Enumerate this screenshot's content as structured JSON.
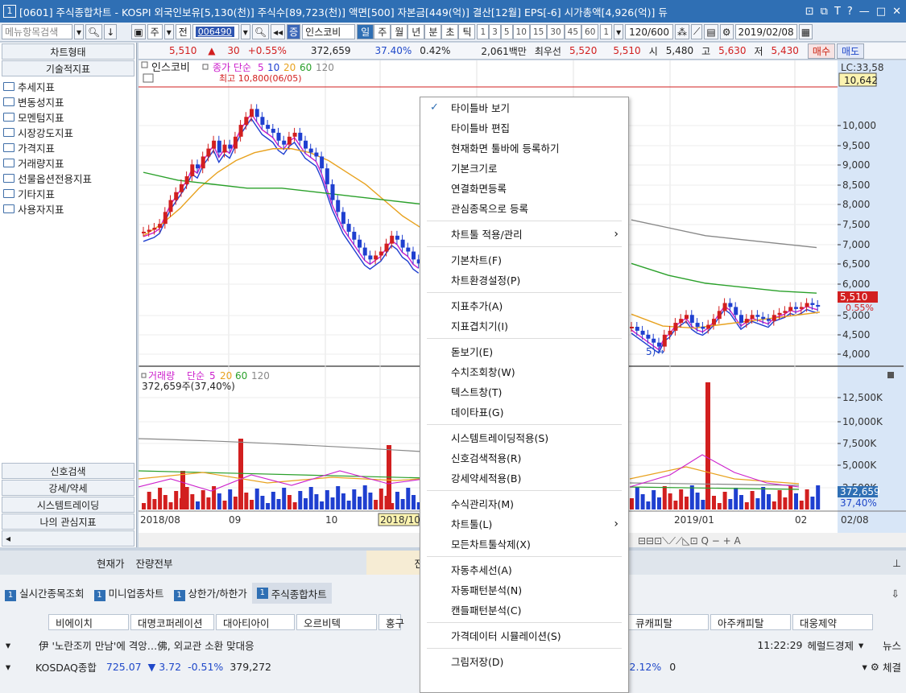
{
  "window": {
    "num": "1",
    "title": "[0601] 주식종합차트 - KOSPI 외국인보유[5,130(천)] 주식수[89,723(천)] 액면[500] 자본금[449(억)] 결산[12월] EPS[-6] 시가총액[4,926(억)] 듀"
  },
  "toolbar": {
    "menu_search": "메뉴항목검색",
    "ju": "주",
    "jeon": "전",
    "code": "006490",
    "name": "인스코비",
    "periods": [
      "일",
      "주",
      "월",
      "년",
      "분",
      "초",
      "틱"
    ],
    "active_period": "일",
    "intervals": [
      "1",
      "3",
      "5",
      "10",
      "15",
      "30",
      "45",
      "60"
    ],
    "count": "1",
    "range": "120",
    "range_total": "/600",
    "date": "2019/02/08"
  },
  "quote": {
    "price": "5,510",
    "arrow": "▲",
    "change": "30",
    "pct": "+0.55%",
    "volume": "372,659",
    "vol_ratio": "37.40%",
    "turnover": "0.42%",
    "amount": "2,061백만",
    "best_label": "최우선",
    "ask": "5,520",
    "bid": "5,510",
    "open_label": "시",
    "open": "5,480",
    "high_label": "고",
    "high": "5,630",
    "low_label": "저",
    "low": "5,430",
    "buy": "매수",
    "sell": "매도"
  },
  "left": {
    "chart_type": "차트형태",
    "tech": "기술적지표",
    "items": [
      "추세지표",
      "변동성지표",
      "모멘텀지표",
      "시장강도지표",
      "가격지표",
      "거래량지표",
      "선물옵션전용지표",
      "기타지표",
      "사용자지표"
    ],
    "bottom": [
      "신호검색",
      "강세/약세",
      "시스템트레이딩",
      "나의 관심지표"
    ]
  },
  "chart": {
    "legend_name": "인스코비",
    "legend_series": "종가 단순",
    "ma": [
      "5",
      "10",
      "20",
      "60",
      "120"
    ],
    "ma_colors": [
      "#cc1fcc",
      "#1f3fd0",
      "#e8a21f",
      "#2aa02a",
      "#888888"
    ],
    "high_note": "최고 10,800(06/05)",
    "lc": "LC:33,58",
    "last_box": "10,642",
    "price_ticks": [
      "10,000",
      "9,500",
      "9,000",
      "8,500",
      "8,000",
      "7,500",
      "7,000",
      "6,500",
      "6,000",
      "5,510",
      "0.55%",
      "5,000",
      "4,500",
      "4,000"
    ],
    "low_note": "5)",
    "vol_legend": "거래량",
    "vol_series": "단순",
    "vol_ma": [
      "5",
      "20",
      "60",
      "120"
    ],
    "vol_text": "372,659주(37,40%)",
    "vol_ticks": [
      "12,500K",
      "10,000K",
      "7,500K",
      "5,000K",
      "2,500K"
    ],
    "vol_last": "372,659",
    "vol_last_pct": "37,40%",
    "x_labels": [
      "2018/08",
      "09",
      "10",
      "2018/10",
      "2019/01",
      "02",
      "02/08"
    ]
  },
  "bottom": {
    "r1": [
      "현재가",
      "잔량전부",
      "잔"
    ],
    "tabs": [
      "실시간종목조회",
      "미니업종차트",
      "상한가/하한가",
      "주식종합차트"
    ],
    "stocks": [
      "비에이치",
      "대명코퍼레이션",
      "대아티아이",
      "오르비텍",
      "홍구",
      "큐캐피탈",
      "아주캐피탈",
      "대웅제약"
    ],
    "news": "伊 '노란조끼 만남'에 격앙…佛, 외교관 소환 맞대응",
    "news_time": "11:22:29",
    "news_src": "헤럴드경제",
    "news_label": "뉴스",
    "idx_name": "KOSDAQ종합",
    "idx_val": "725.07",
    "idx_arrow": "▼",
    "idx_chg": "3.72",
    "idx_pct": "-0.51%",
    "idx_vol": "379,272",
    "idx2": "-2.12%",
    "idx2b": "0",
    "settle": "체결"
  },
  "menu": [
    {
      "label": "타이틀바 보기",
      "chk": true
    },
    {
      "label": "타이틀바 편집"
    },
    {
      "label": "현재화면 툴바에 등록하기"
    },
    {
      "label": "기본크기로"
    },
    {
      "label": "연결화면등록"
    },
    {
      "label": "관심종목으로 등록"
    },
    {
      "sep": true
    },
    {
      "label": "차트툴 적용/관리",
      "sub": true
    },
    {
      "sep": true
    },
    {
      "label": "기본차트(F)"
    },
    {
      "label": "차트환경설정(P)"
    },
    {
      "sep": true
    },
    {
      "label": "지표추가(A)"
    },
    {
      "label": "지표겹치기(I)"
    },
    {
      "sep": true
    },
    {
      "label": "돋보기(E)"
    },
    {
      "label": "수치조회창(W)"
    },
    {
      "label": "텍스트창(T)"
    },
    {
      "label": "데이타표(G)"
    },
    {
      "sep": true
    },
    {
      "label": "시스템트레이딩적용(S)"
    },
    {
      "label": "신호검색적용(R)"
    },
    {
      "label": "강세약세적용(B)"
    },
    {
      "sep": true
    },
    {
      "label": "수식관리자(M)"
    },
    {
      "label": "차트툴(L)",
      "sub": true
    },
    {
      "label": "모든차트툴삭제(X)"
    },
    {
      "sep": true
    },
    {
      "label": "자동추세선(A)"
    },
    {
      "label": "자동패턴분석(N)"
    },
    {
      "label": "캔들패턴분석(C)"
    },
    {
      "sep": true
    },
    {
      "label": "가격데이터 시뮬레이션(S)"
    },
    {
      "sep": true
    },
    {
      "label": "그림저장(D)"
    }
  ]
}
